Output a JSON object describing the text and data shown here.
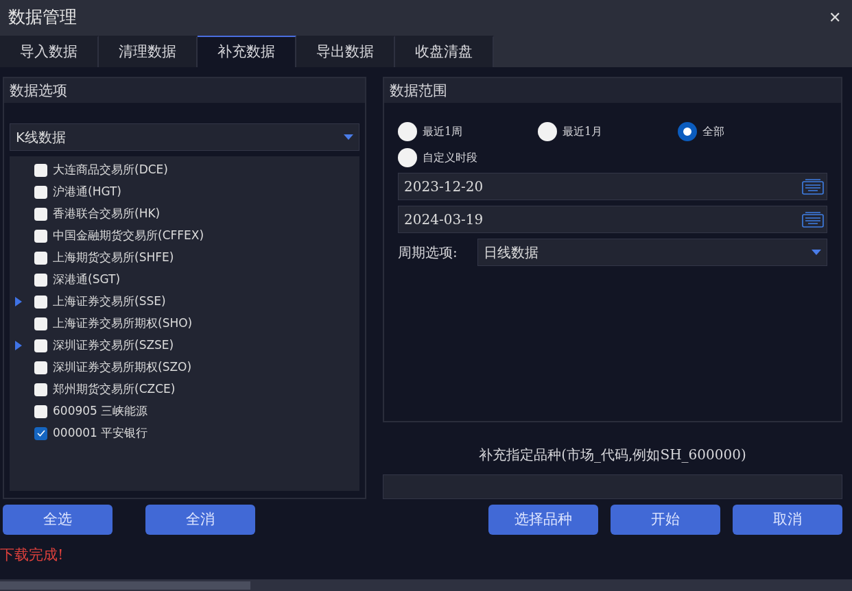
{
  "window": {
    "title": "数据管理",
    "close": "✕"
  },
  "tabs": [
    {
      "label": "导入数据",
      "selected": false
    },
    {
      "label": "清理数据",
      "selected": false
    },
    {
      "label": "补充数据",
      "selected": true
    },
    {
      "label": "导出数据",
      "selected": false
    },
    {
      "label": "收盘清盘",
      "selected": false
    }
  ],
  "data_options": {
    "title": "数据选项",
    "data_type": "K线数据",
    "items": [
      {
        "label": "大连商品交易所(DCE)",
        "checked": false,
        "expandable": false
      },
      {
        "label": "沪港通(HGT)",
        "checked": false,
        "expandable": false
      },
      {
        "label": "香港联合交易所(HK)",
        "checked": false,
        "expandable": false
      },
      {
        "label": "中国金融期货交易所(CFFEX)",
        "checked": false,
        "expandable": false
      },
      {
        "label": "上海期货交易所(SHFE)",
        "checked": false,
        "expandable": false
      },
      {
        "label": "深港通(SGT)",
        "checked": false,
        "expandable": false
      },
      {
        "label": "上海证券交易所(SSE)",
        "checked": false,
        "expandable": true
      },
      {
        "label": "上海证券交易所期权(SHO)",
        "checked": false,
        "expandable": false
      },
      {
        "label": "深圳证券交易所(SZSE)",
        "checked": false,
        "expandable": true
      },
      {
        "label": "深圳证券交易所期权(SZO)",
        "checked": false,
        "expandable": false
      },
      {
        "label": "郑州期货交易所(CZCE)",
        "checked": false,
        "expandable": false
      },
      {
        "label": "600905 三峡能源",
        "checked": false,
        "expandable": false
      },
      {
        "label": "000001 平安银行",
        "checked": true,
        "expandable": false
      }
    ],
    "buttons": [
      "全选",
      "全消"
    ]
  },
  "data_range": {
    "title": "数据范围",
    "options": [
      {
        "label": "最近1周",
        "selected": false
      },
      {
        "label": "最近1月",
        "selected": false
      },
      {
        "label": "全部",
        "selected": true
      },
      {
        "label": "自定义时段",
        "selected": false
      }
    ],
    "start_date": "2023-12-20",
    "end_date": "2024-03-19",
    "period_label": "周期选项:",
    "period": "日线数据"
  },
  "symbol_label": "补充指定品种(市场_代码,例如SH_600000)",
  "action_buttons": [
    "选择品种",
    "开始",
    "取消"
  ],
  "status": "下载完成!"
}
